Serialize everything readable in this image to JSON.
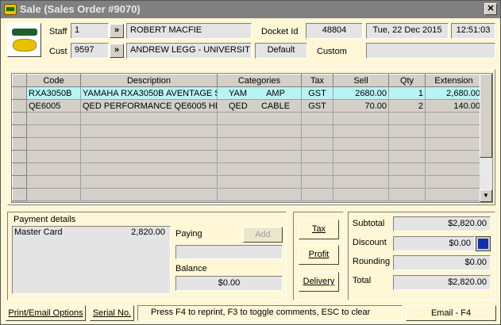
{
  "window": {
    "title": "Sale (Sales Order #9070)",
    "close_label": "✕"
  },
  "header": {
    "staff_label": "Staff",
    "staff_code": "1",
    "staff_name": "ROBERT  MACFIE",
    "cust_label": "Cust",
    "cust_code": "9597",
    "cust_name": "ANDREW LEGG - UNIVERSIT",
    "lookup_label": "»",
    "docket_label": "Docket Id",
    "docket_id": "48804",
    "date": "Tue, 22 Dec 2015",
    "time": "12:51:03",
    "price_level": "Default",
    "custom_label": "Custom",
    "custom_value": ""
  },
  "grid": {
    "columns": [
      "Code",
      "Description",
      "Categories",
      "Tax",
      "Sell",
      "Qty",
      "Extension"
    ],
    "rows": [
      {
        "code": "RXA3050B",
        "description": "YAMAHA RXA3050B AVENTAGE S",
        "cat1": "YAM",
        "cat2": "AMP",
        "tax": "GST",
        "sell": "2680.00",
        "qty": "1",
        "extension": "2,680.00"
      },
      {
        "code": "QE6005",
        "description": "QED PERFORMANCE QE6005 HD",
        "cat1": "QED",
        "cat2": "CABLE",
        "tax": "GST",
        "sell": "70.00",
        "qty": "2",
        "extension": "140.00"
      }
    ]
  },
  "payment": {
    "title": "Payment details",
    "items": [
      {
        "method": "Master Card",
        "amount": "2,820.00"
      }
    ],
    "paying_label": "Paying",
    "add_label": "Add",
    "paying_value": "",
    "balance_label": "Balance",
    "balance_value": "$0.00"
  },
  "actions": {
    "tax": "Tax",
    "profit": "Profit",
    "delivery": "Delivery"
  },
  "totals": {
    "subtotal_label": "Subtotal",
    "subtotal": "$2,820.00",
    "discount_label": "Discount",
    "discount": "$0.00",
    "rounding_label": "Rounding",
    "rounding": "$0.00",
    "total_label": "Total",
    "total": "$2,820.00"
  },
  "statusbar": {
    "print_email": "Print/Email Options",
    "serial": "Serial No.",
    "hint": "Press F4 to reprint, F3 to toggle comments, ESC to clear",
    "email": "Email - F4"
  },
  "colors": {
    "window_bg": "#fff7d6",
    "titlebar": "#808080",
    "selected_row": "#b8f4f4",
    "discount_swatch": "#1030b0"
  }
}
